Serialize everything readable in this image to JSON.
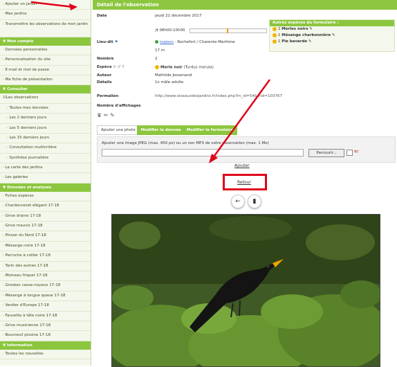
{
  "sidebar": {
    "items_top": [
      {
        "label": "· Ajouter un jardin"
      },
      {
        "label": "· Mes jardins"
      }
    ],
    "transmit_label": "· Transmettre les observations de mon jardin",
    "section_account": "▼ Mon compte",
    "account_items": [
      {
        "label": "· Données personnelles"
      },
      {
        "label": "· Personnalisation du site"
      },
      {
        "label": "· E-mail et mot de passe"
      },
      {
        "label": "· Ma fiche de présentation"
      }
    ],
    "section_consult": "▼ Consulter",
    "consult_items": [
      {
        "label": "Les observations",
        "kind": "checked"
      },
      {
        "label": "· Toutes mes données",
        "kind": "sub"
      },
      {
        "label": "· Les 2 derniers jours",
        "kind": "sub"
      },
      {
        "label": "· Les 5 derniers jours",
        "kind": "sub"
      },
      {
        "label": "· Les 15 derniers jours",
        "kind": "sub"
      },
      {
        "label": "· Consultation multicritère",
        "kind": "sub"
      },
      {
        "label": "· Synthèse journalière",
        "kind": "sub"
      },
      {
        "label": "· La carte des jardins",
        "kind": ""
      },
      {
        "label": "· Les galeries",
        "kind": ""
      }
    ],
    "section_data": "▼ Données et analyses",
    "data_items": [
      {
        "label": "· Fiches espèces"
      },
      {
        "label": "· Chardonneret élégant 17-18"
      },
      {
        "label": "· Grive draine 17-18"
      },
      {
        "label": "· Grive mauvis 17-18"
      },
      {
        "label": "· Pinson du Nord 17-18"
      },
      {
        "label": "· Mésange noire 17-18"
      },
      {
        "label": "· Perruche à collier 17-18"
      },
      {
        "label": "· Tarin des aulnes 17-18"
      },
      {
        "label": "· Moineau friquet 17-18"
      },
      {
        "label": "· Grosbec casse-noyaux 17-18"
      },
      {
        "label": "· Mésange à longue queue 17-18"
      },
      {
        "label": "· Verdier d'Europe 17-18"
      },
      {
        "label": "· Fauvette à tête noire 17-18"
      },
      {
        "label": "· Grive musicienne 17-18"
      },
      {
        "label": "· Bouvreuil pivoine 17-18"
      }
    ],
    "section_info": "▼ Information",
    "info_items": [
      {
        "label": "· Toutes les nouvelles"
      }
    ]
  },
  "main": {
    "header_title": "Détail de l'observation",
    "fields": {
      "date_label": "Date",
      "date_value": "jeudi 21 décembre 2017",
      "time_range": "08h00-10h00",
      "place_label": "Lieu-dit",
      "place_value": "maison",
      "place_location": "· Rochefort / Charente-Maritime",
      "place_altitude": "17 m",
      "number_label": "Nombre",
      "number_value": "2",
      "species_label": "Espèce",
      "species_value": "Merle noir",
      "species_latin": "(Turdus merula)",
      "author_label": "Auteur",
      "author_value": "Mathilde Jossenand",
      "details_label": "Détails",
      "details_value": "1x mâle adulte",
      "permalink_label": "Permalien",
      "permalink_value": "http://www.oiseauxdesjardins.fr/index.php?m_id=54&mid=103767",
      "views_label": "Nombre d'affichages"
    },
    "other_species": {
      "title": "Autres espèces du formulaire :",
      "rows": [
        {
          "count": "2",
          "name": "Merles noirs"
        },
        {
          "count": "1",
          "name": "Mésange charbonnière"
        },
        {
          "count": "1",
          "name": "Pie bavarde"
        }
      ]
    },
    "tabs": [
      {
        "label": "Ajouter une photo",
        "active": false
      },
      {
        "label": "Modifier la donnée",
        "active": true
      },
      {
        "label": "Modifier le formulaire",
        "active": true
      }
    ],
    "upload": {
      "instruction": "Ajouter une image JPEG (max. 450 px) ou un son MP3 de votre observation (max. 1 Mo)",
      "browse_label": "Parcourir..."
    },
    "add_label": "Ajouter",
    "back_label": "Retour",
    "colors": {
      "accent": "#8cc63f",
      "highlight": "#e0001a"
    }
  }
}
